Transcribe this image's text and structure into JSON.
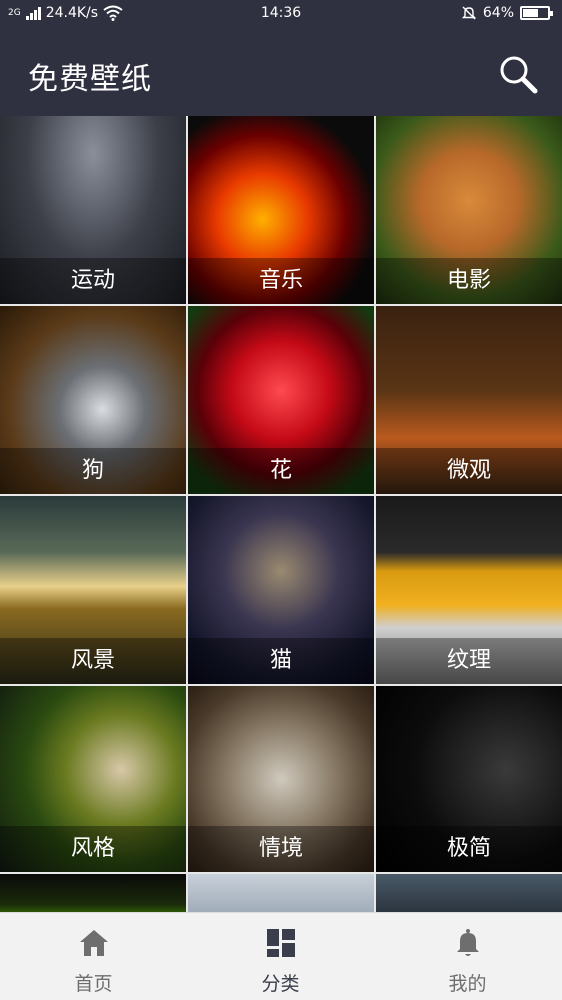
{
  "status_bar": {
    "signal_label": "2G",
    "network_speed": "24.4K/s",
    "time": "14:36",
    "battery_percent": "64%",
    "battery_level": 0.64
  },
  "app_bar": {
    "title": "免费壁纸",
    "search_icon": "search-icon"
  },
  "categories": [
    {
      "label": "运动"
    },
    {
      "label": "音乐"
    },
    {
      "label": "电影"
    },
    {
      "label": "狗"
    },
    {
      "label": "花"
    },
    {
      "label": "微观"
    },
    {
      "label": "风景"
    },
    {
      "label": "猫"
    },
    {
      "label": "纹理"
    },
    {
      "label": "风格"
    },
    {
      "label": "情境"
    },
    {
      "label": "极简"
    }
  ],
  "bottom_nav": [
    {
      "label": "首页",
      "icon": "home-icon",
      "active": false
    },
    {
      "label": "分类",
      "icon": "grid-icon",
      "active": true
    },
    {
      "label": "我的",
      "icon": "bell-icon",
      "active": false
    }
  ],
  "colors": {
    "header_bg": "#2f3140",
    "nav_active": "#3a3d4c",
    "nav_inactive": "#6e6e6e"
  }
}
